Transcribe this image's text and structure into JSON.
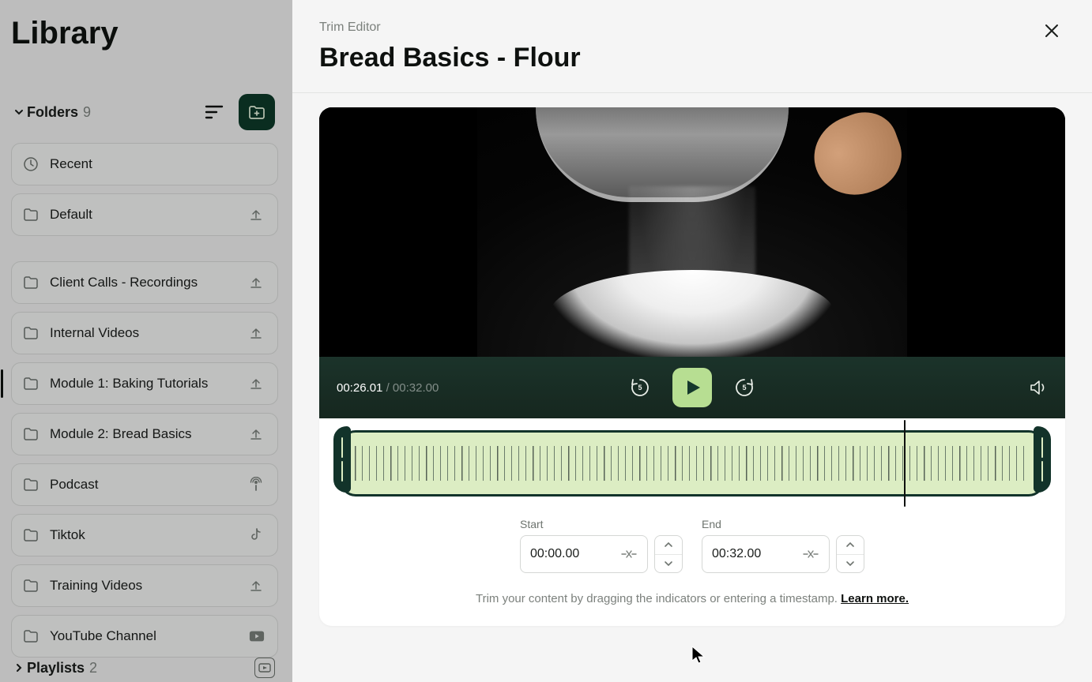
{
  "sidebar": {
    "title": "Library",
    "folders_label": "Folders",
    "folders_count": "9",
    "playlists_label": "Playlists",
    "playlists_count": "2",
    "items": [
      {
        "label": "Recent",
        "icon": "clock",
        "action": null
      },
      {
        "label": "Default",
        "icon": "folder",
        "action": "upload"
      },
      {
        "label": "Client Calls - Recordings",
        "icon": "folder",
        "action": "upload"
      },
      {
        "label": "Internal Videos",
        "icon": "folder",
        "action": "upload"
      },
      {
        "label": "Module 1: Baking Tutorials",
        "icon": "folder",
        "action": "upload",
        "selected": true
      },
      {
        "label": "Module 2: Bread Basics",
        "icon": "folder",
        "action": "upload"
      },
      {
        "label": "Podcast",
        "icon": "folder",
        "action": "podcast"
      },
      {
        "label": "Tiktok",
        "icon": "folder",
        "action": "tiktok"
      },
      {
        "label": "Training Videos",
        "icon": "folder",
        "action": "upload"
      },
      {
        "label": "YouTube Channel",
        "icon": "folder",
        "action": "youtube"
      }
    ]
  },
  "modal": {
    "subtitle": "Trim Editor",
    "title": "Bread Basics - Flour",
    "current_time": "00:26.01",
    "duration": "00:32.00",
    "skip_seconds": "5",
    "start_label": "Start",
    "end_label": "End",
    "start_value": "00:00.00",
    "end_value": "00:32.00",
    "playhead_percent": 81,
    "hint_text": "Trim your content by dragging the indicators or entering a timestamp. ",
    "learn_more": "Learn more."
  }
}
